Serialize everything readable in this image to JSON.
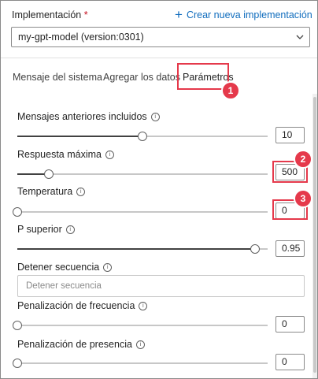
{
  "deployment": {
    "label": "Implementación",
    "required_mark": "*",
    "new_link": "Crear nueva implementación",
    "selected": "my-gpt-model (version:0301)"
  },
  "tabs": [
    {
      "label": "Mensaje del sistema"
    },
    {
      "label": "Agregar los datos"
    },
    {
      "label": "Parámetros",
      "active": true
    }
  ],
  "callouts": [
    "1",
    "2",
    "3"
  ],
  "params": {
    "past_messages": {
      "label": "Mensajes anteriores incluidos",
      "value": "10",
      "level": 0.5
    },
    "max_response": {
      "label": "Respuesta máxima",
      "value": "500",
      "level": 0.125
    },
    "temperature": {
      "label": "Temperatura",
      "value": "0",
      "level": 0
    },
    "top_p": {
      "label": "P superior",
      "value": "0.95",
      "level": 0.95
    },
    "stop_sequence": {
      "label": "Detener secuencia",
      "placeholder": "Detener secuencia"
    },
    "frequency_penalty": {
      "label": "Penalización de frecuencia",
      "value": "0",
      "level": 0
    },
    "presence_penalty": {
      "label": "Penalización de presencia",
      "value": "0",
      "level": 0
    }
  },
  "colors": {
    "accent": "#0f6cbd",
    "highlight": "#e5394b"
  }
}
